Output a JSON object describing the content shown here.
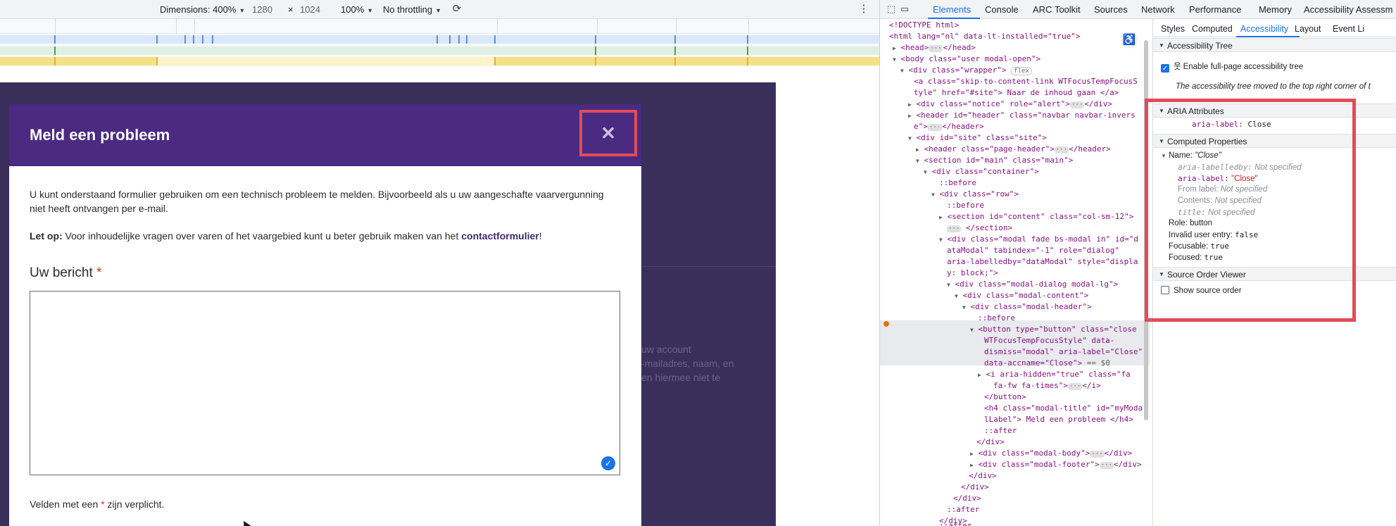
{
  "device_toolbar": {
    "dimensions_label": "Dimensions: 400%",
    "width": "1280",
    "times": "×",
    "height": "1024",
    "zoom": "100%",
    "throttling": "No throttling"
  },
  "modal": {
    "title": "Meld een probleem",
    "close_glyph": "✕",
    "intro": "U kunt onderstaand formulier gebruiken om een technisch probleem te melden. Bijvoorbeeld als u uw aangeschafte vaarvergunning niet heeft ontvangen per e-mail.",
    "note_bold": "Let op:",
    "note_text": "Voor inhoudelijke vragen over varen of het vaargebied kunt u beter gebruik maken van het",
    "note_link": "contactformulier",
    "note_end": "!",
    "message_label": "Uw bericht",
    "required_star": "*",
    "required_note_pre": "Velden met een",
    "required_note_post": "zijn verplicht."
  },
  "background_text": {
    "line1": "uw account",
    "line2": "-mailadres, naam, en",
    "line3": "en hiermee niet te"
  },
  "devtools": {
    "tabs": [
      "Elements",
      "Console",
      "ARC Toolkit",
      "Sources",
      "Network",
      "Performance",
      "Memory",
      "Accessibility Assessm"
    ],
    "active_tab": "Elements",
    "right_tabs": [
      "Styles",
      "Computed",
      "Accessibility",
      "Layout",
      "Event Li"
    ],
    "active_right_tab": "Accessibility",
    "dom": {
      "doctype": "<!DOCTYPE html>",
      "html_open": "<html lang=\"nl\" data-lt-installed=\"true\">",
      "head": "<head>",
      "head_close": "</head>",
      "body": "<body class=\"user modal-open\">",
      "wrapper": "<div class=\"wrapper\">",
      "flex": "flex",
      "skip1": "<a class=\"skip-to-content-link WTFocusTempFocusS",
      "skip2": "tyle\" href=\"#site\"> Naar de inhoud gaan </a>",
      "notice": "<div class=\"notice\" role=\"alert\">",
      "notice_close": "</div>",
      "header1": "<header id=\"header\" class=\"navbar navbar-invers",
      "header2": "e\">",
      "header2_close": "</header>",
      "site": "<div id=\"site\" class=\"site\">",
      "page_header": "<header class=\"page-header\">",
      "page_header_close": "</header>",
      "main": "<section id=\"main\" class=\"main\">",
      "container": "<div class=\"container\">",
      "before": "::before",
      "row": "<div class=\"row\">",
      "content": "<section id=\"content\" class=\"col-sm-12\">",
      "section_close": "</section>",
      "modal1": "<div class=\"modal fade bs-modal in\" id=\"d",
      "modal2": "ataModal\" tabindex=\"-1\" role=\"dialog\"",
      "modal3": "aria-labelledby=\"dataModal\" style=\"displa",
      "modal4": "y: block;\">",
      "dialog": "<div class=\"modal-dialog modal-lg\">",
      "mcontent": "<div class=\"modal-content\">",
      "mheader": "<div class=\"modal-header\">",
      "btn1": "<button type=\"button\" class=\"close",
      "btn2": "WTFocusTempFocusStyle\" data-",
      "btn3": "dismiss=\"modal\" aria-label=\"Close\"",
      "btn4": "data-accname=\"Close\">",
      "eq": "== $0",
      "i1": "<i aria-hidden=\"true\" class=\"fa",
      "i2": "fa-fw fa-times\">",
      "i2_close": "</i>",
      "button_close": "</button>",
      "h4_1": "<h4 class=\"modal-title\" id=\"myModa",
      "h4_2": "lLabel\"> Meld een probleem </h4>",
      "after": "::after",
      "div_close": "</div>",
      "mbody": "<div class=\"modal-body\">",
      "mfooter": "<div class=\"modal-footer\">"
    },
    "a11y": {
      "tree_header": "Accessibility Tree",
      "enable_label": "Enable full-page accessibility tree",
      "moved_note": "The accessibility tree moved to the top right corner of t",
      "aria_header": "ARIA Attributes",
      "aria_label_key": "aria-label:",
      "aria_label_val": "Close",
      "computed_header": "Computed Properties",
      "name_key": "Name:",
      "name_val": "\"Close\"",
      "labelledby_key": "aria-labelledby:",
      "labelledby_val": "Not specified",
      "arialabel_key": "aria-label:",
      "arialabel_val": "\"Close\"",
      "fromlabel_key": "From label:",
      "fromlabel_val": "Not specified",
      "contents_key": "Contents:",
      "contents_val": "Not specified",
      "title_key": "title:",
      "title_val": "Not specified",
      "role_key": "Role:",
      "role_val": "button",
      "invalid_key": "Invalid user entry:",
      "invalid_val": "false",
      "focusable_key": "Focusable:",
      "focusable_val": "true",
      "focused_key": "Focused:",
      "focused_val": "true",
      "source_header": "Source Order Viewer",
      "source_label": "Show source order"
    }
  },
  "colors": {
    "modal_header": "#4b2a82",
    "backdrop": "#3a2f5b",
    "highlight": "#e04d57",
    "devtools_accent": "#1a73e8"
  }
}
